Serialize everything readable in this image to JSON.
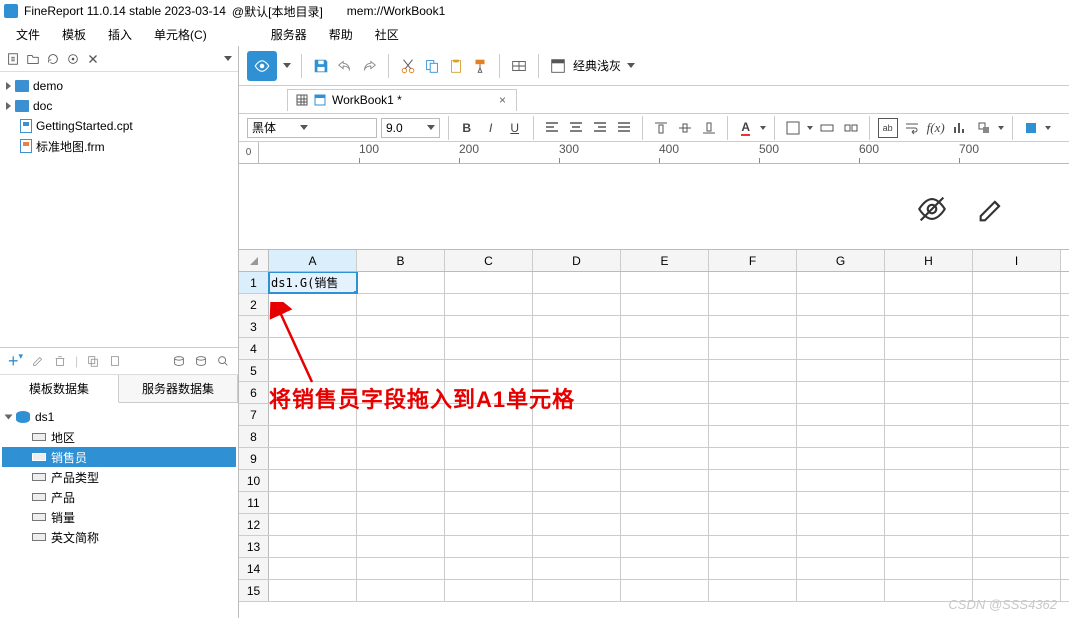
{
  "title": {
    "app": "FineReport 11.0.14 stable 2023-03-14",
    "user": "@默认[本地目录]",
    "doc": "mem://WorkBook1"
  },
  "menu": [
    "文件",
    "模板",
    "插入",
    "单元格(C)",
    "服务器",
    "帮助",
    "社区"
  ],
  "file_tree": [
    {
      "type": "folder",
      "label": "demo",
      "level": 0,
      "open": false
    },
    {
      "type": "folder",
      "label": "doc",
      "level": 0,
      "open": false
    },
    {
      "type": "cpt",
      "label": "GettingStarted.cpt",
      "level": 0
    },
    {
      "type": "frm",
      "label": "标准地图.frm",
      "level": 0
    }
  ],
  "ds_tabs": {
    "tab1": "模板数据集",
    "tab2": "服务器数据集"
  },
  "ds_tree": {
    "root": "ds1",
    "fields": [
      "地区",
      "销售员",
      "产品类型",
      "产品",
      "销量",
      "英文简称"
    ],
    "selected": "销售员"
  },
  "format_bar": {
    "font": "黑体",
    "size": "9.0",
    "bold": "B",
    "italic": "I",
    "underline": "U"
  },
  "doc_tab": {
    "label": "WorkBook1 *",
    "close": "×"
  },
  "ruler": {
    "origin": "0",
    "ticks": [
      "100",
      "200",
      "300",
      "400",
      "500",
      "600",
      "700"
    ]
  },
  "columns": [
    "A",
    "B",
    "C",
    "D",
    "E",
    "F",
    "G",
    "H",
    "I"
  ],
  "rows": 15,
  "cell_a1": "ds1.G(销售",
  "annotation": "将销售员字段拖入到A1单元格",
  "watermark": "CSDN @SSS4362",
  "toolbar": {
    "classic": "经典浅灰"
  }
}
